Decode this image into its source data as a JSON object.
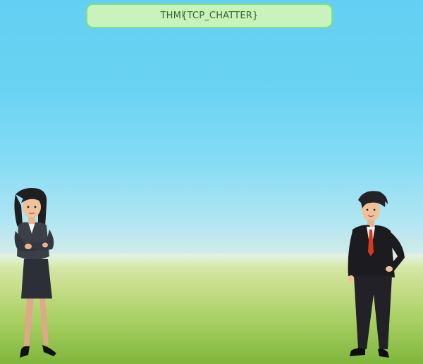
{
  "flag": {
    "text": "THM{TCP_CHATTER}"
  },
  "characters": {
    "left": {
      "icon": "businesswoman-icon"
    },
    "right": {
      "icon": "businessman-icon"
    }
  },
  "colors": {
    "sky_top": "#63cff2",
    "grass_bottom": "#7fb63c",
    "box_fill": "#c9f2bd",
    "box_border": "#7ee37a"
  }
}
